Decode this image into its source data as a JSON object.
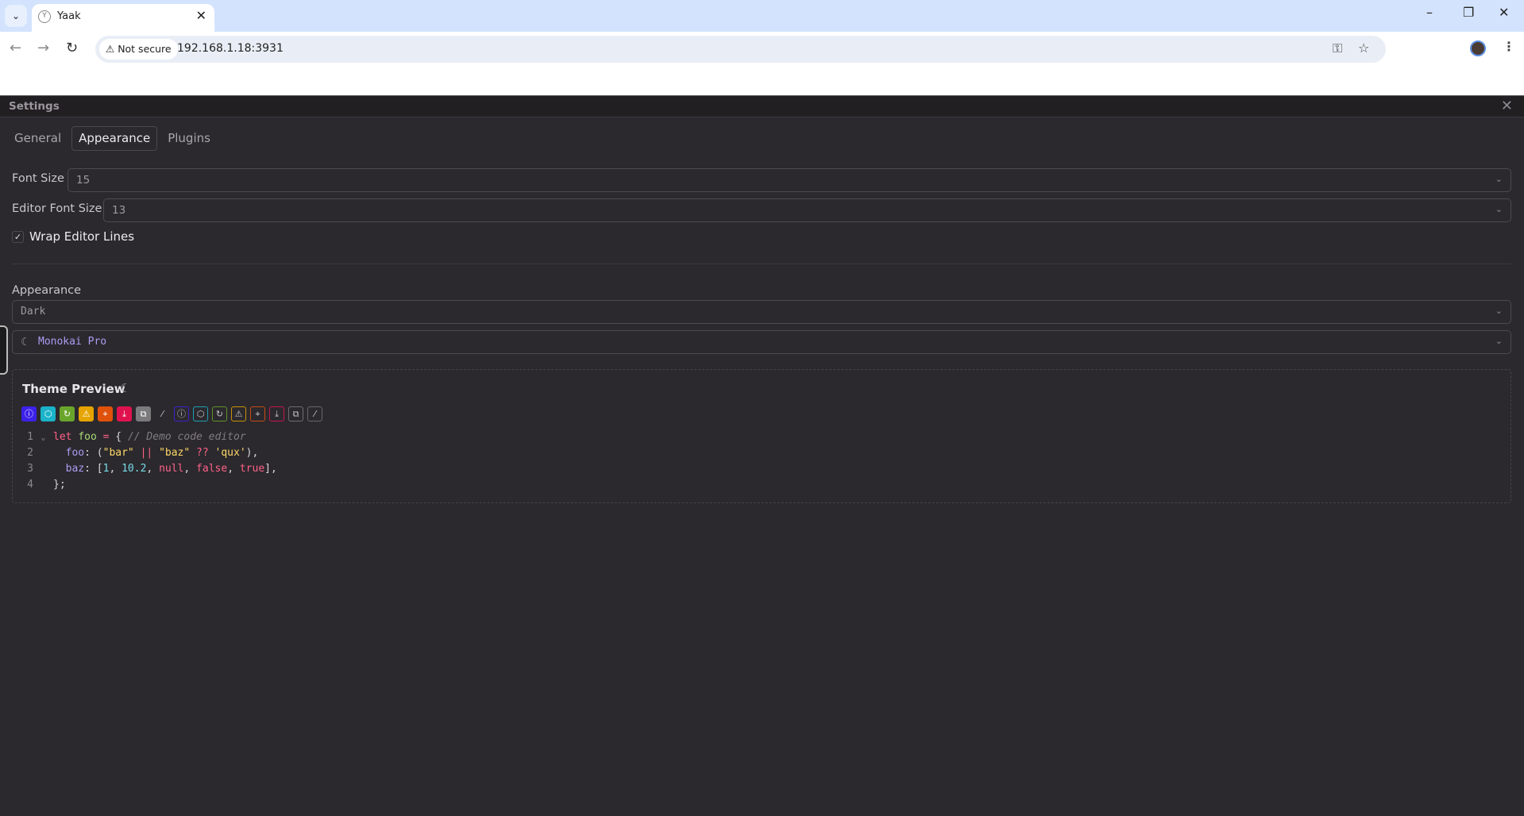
{
  "browser": {
    "tab_title": "Yaak",
    "security_label": "Not secure",
    "url": "192.168.1.18:3931"
  },
  "settings": {
    "title": "Settings",
    "tabs": [
      {
        "label": "General"
      },
      {
        "label": "Appearance",
        "active": true
      },
      {
        "label": "Plugins"
      }
    ],
    "font_size": {
      "label": "Font Size",
      "value": "15"
    },
    "editor_font_size": {
      "label": "Editor Font Size",
      "value": "13"
    },
    "wrap_editor_lines": {
      "label": "Wrap Editor Lines",
      "checked": true
    },
    "appearance": {
      "label": "Appearance",
      "value": "Dark"
    },
    "theme": {
      "value": "Monokai Pro",
      "icon": "moon-icon"
    },
    "preview": {
      "title": "Theme Preview",
      "icon_colors": {
        "primary": "#3c21e8",
        "info": "#1ab3c9",
        "success": "#6aa52b",
        "warning": "#e6a400",
        "notice": "#e0520c",
        "danger": "#e0124e",
        "secondary": "#7b7a7c"
      },
      "code_lines": [
        {
          "num": "1",
          "tokens": [
            [
              "kw",
              "let"
            ],
            [
              "pu",
              " "
            ],
            [
              "id",
              "foo"
            ],
            [
              "pu",
              " "
            ],
            [
              "kw",
              "="
            ],
            [
              "pu",
              " { "
            ],
            [
              "cm",
              "// Demo code editor"
            ]
          ]
        },
        {
          "num": "2",
          "tokens": [
            [
              "pu",
              "  "
            ],
            [
              "pr",
              "foo"
            ],
            [
              "pu",
              ": ("
            ],
            [
              "st",
              "\"bar\""
            ],
            [
              "pu",
              " "
            ],
            [
              "kw",
              "||"
            ],
            [
              "pu",
              " "
            ],
            [
              "st",
              "\"baz\""
            ],
            [
              "pu",
              " "
            ],
            [
              "kw",
              "??"
            ],
            [
              "pu",
              " "
            ],
            [
              "st",
              "'qux'"
            ],
            [
              "pu",
              "),"
            ]
          ]
        },
        {
          "num": "3",
          "tokens": [
            [
              "pu",
              "  "
            ],
            [
              "pr",
              "baz"
            ],
            [
              "pu",
              ": ["
            ],
            [
              "nu",
              "1"
            ],
            [
              "pu",
              ", "
            ],
            [
              "nu",
              "10.2"
            ],
            [
              "pu",
              ", "
            ],
            [
              "kw",
              "null"
            ],
            [
              "pu",
              ", "
            ],
            [
              "kw",
              "false"
            ],
            [
              "pu",
              ", "
            ],
            [
              "kw",
              "true"
            ],
            [
              "pu",
              "],"
            ]
          ]
        },
        {
          "num": "4",
          "tokens": [
            [
              "pu",
              "};"
            ]
          ]
        }
      ]
    }
  }
}
